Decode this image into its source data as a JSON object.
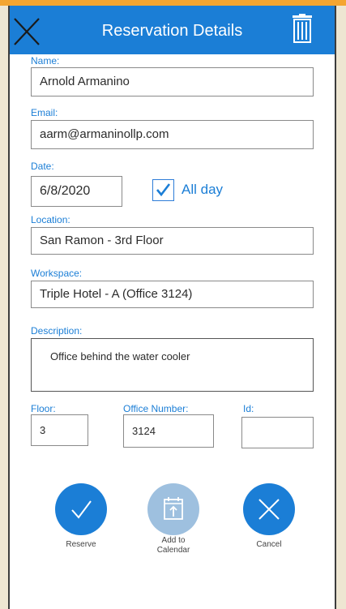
{
  "header": {
    "title": "Reservation Details"
  },
  "form": {
    "name_label": "Name:",
    "name_value": "Arnold Armanino",
    "email_label": "Email:",
    "email_value": "aarm@armaninollp.com",
    "date_label": "Date:",
    "date_value": "6/8/2020",
    "allday_label": "All day",
    "allday_checked": true,
    "location_label": "Location:",
    "location_value": "San Ramon - 3rd Floor",
    "workspace_label": "Workspace:",
    "workspace_value": "Triple Hotel - A (Office 3124)",
    "description_label": "Description:",
    "description_value": "Office behind the water cooler",
    "floor_label": "Floor:",
    "floor_value": "3",
    "office_label": "Office Number:",
    "office_value": "3124",
    "id_label": "Id:",
    "id_value": ""
  },
  "actions": {
    "reserve_label": "Reserve",
    "calendar_label_line1": "Add to",
    "calendar_label_line2": "Calendar",
    "cancel_label": "Cancel"
  },
  "colors": {
    "accent": "#1b7ed6",
    "accent_disabled": "#9ec0df",
    "frame": "#f4a531"
  },
  "icons": [
    "close-icon",
    "trash-icon",
    "checkmark-icon",
    "calendar-icon"
  ]
}
